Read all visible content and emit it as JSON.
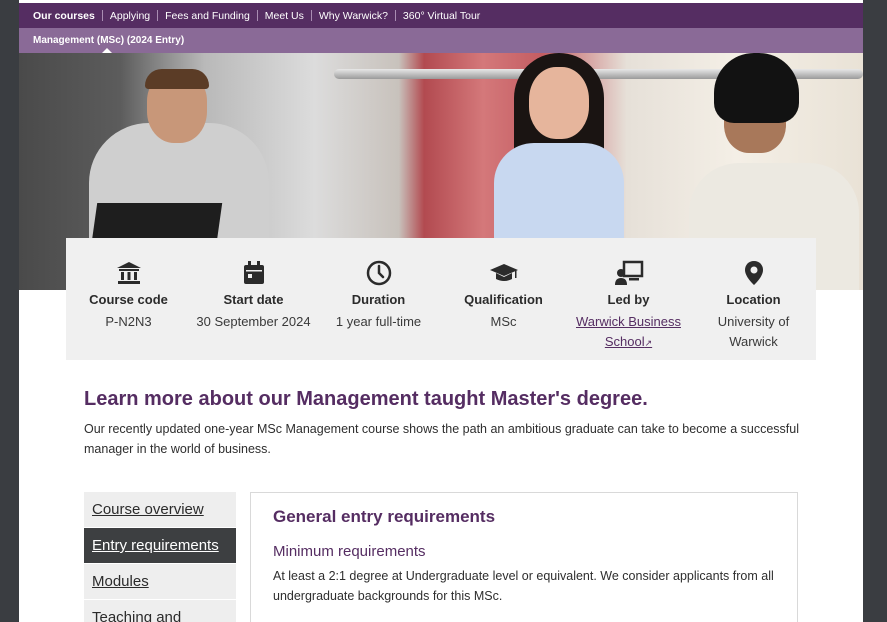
{
  "nav_primary": {
    "items": [
      {
        "label": "Our courses",
        "active": true
      },
      {
        "label": "Applying"
      },
      {
        "label": "Fees and Funding"
      },
      {
        "label": "Meet Us"
      },
      {
        "label": "Why Warwick?"
      },
      {
        "label": "360° Virtual Tour"
      }
    ]
  },
  "nav_secondary": {
    "label": "Management (MSc) (2024 Entry)"
  },
  "course_info": {
    "items": [
      {
        "icon": "institution-icon",
        "label": "Course code",
        "value": "P-N2N3"
      },
      {
        "icon": "calendar-icon",
        "label": "Start date",
        "value": "30 September 2024"
      },
      {
        "icon": "clock-icon",
        "label": "Duration",
        "value": "1 year full-time"
      },
      {
        "icon": "graduation-cap-icon",
        "label": "Qualification",
        "value": "MSc"
      },
      {
        "icon": "teacher-icon",
        "label": "Led by",
        "value_line1": "Warwick Business",
        "value_line2": "School"
      },
      {
        "icon": "map-pin-icon",
        "label": "Location",
        "value_line1": "University of",
        "value_line2": "Warwick"
      }
    ]
  },
  "intro": {
    "title": "Learn more about our Management taught Master's degree.",
    "text": "Our recently updated one-year MSc Management course shows the path an ambitious graduate can take to become a successful manager in the world of business."
  },
  "sidenav": {
    "items": [
      {
        "label": "Course overview"
      },
      {
        "label": "Entry requirements",
        "active": true
      },
      {
        "label": "Modules"
      },
      {
        "label": "Teaching and"
      }
    ]
  },
  "panel": {
    "title": "General entry requirements",
    "subtitle": "Minimum requirements",
    "text": "At least a 2:1 degree at Undergraduate level or equivalent. We consider applicants from all undergraduate backgrounds for this MSc."
  },
  "colors": {
    "brand_purple": "#552d62",
    "secondary_purple": "#8a6a97",
    "active_nav": "#3d3f41"
  }
}
